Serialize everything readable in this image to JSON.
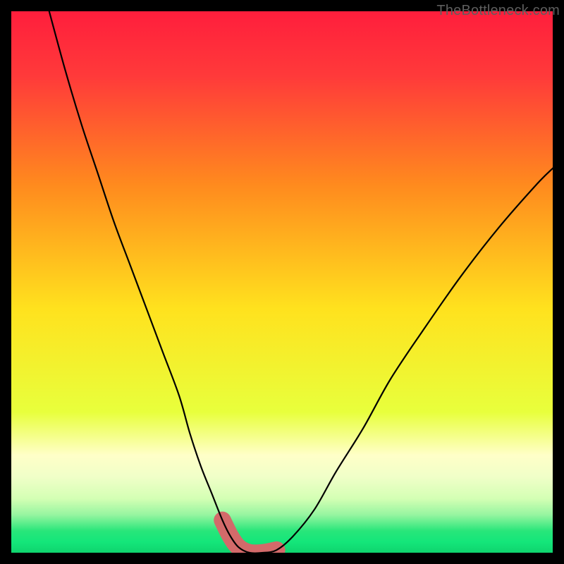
{
  "watermark": {
    "text": "TheBottleneck.com"
  },
  "palette": {
    "red": "#ff1e3c",
    "orange": "#ff8a1e",
    "yellow": "#ffe21e",
    "lime": "#d4ff1e",
    "pale": "#eaffbe",
    "green": "#14e67a",
    "green2": "#0fd46e",
    "curve": "#000000",
    "band": "#d36a6a"
  },
  "chart_data": {
    "type": "line",
    "title": "",
    "xlabel": "",
    "ylabel": "",
    "xlim": [
      0,
      100
    ],
    "ylim": [
      0,
      100
    ],
    "series": [
      {
        "name": "bottleneck-curve",
        "x": [
          7,
          10,
          13,
          16,
          19,
          22,
          25,
          28,
          31,
          33,
          35,
          37,
          39,
          40.5,
          42,
          44,
          46.5,
          49,
          52,
          56,
          60,
          65,
          70,
          76,
          83,
          90,
          97,
          100
        ],
        "values": [
          100,
          89,
          79,
          70,
          61,
          53,
          45,
          37,
          29,
          22,
          16,
          11,
          6,
          3,
          1,
          0,
          0,
          0.5,
          3,
          8,
          15,
          23,
          32,
          41,
          51,
          60,
          68,
          71
        ]
      }
    ],
    "band": {
      "x_start": 38,
      "x_end": 51,
      "thickness_pct": 3.2
    },
    "gradient_stops": [
      {
        "pct": 0,
        "color": "#ff1e3c"
      },
      {
        "pct": 12,
        "color": "#ff3a3a"
      },
      {
        "pct": 32,
        "color": "#ff8a1e"
      },
      {
        "pct": 55,
        "color": "#ffe21e"
      },
      {
        "pct": 74,
        "color": "#e8ff3c"
      },
      {
        "pct": 82,
        "color": "#ffffc8"
      },
      {
        "pct": 86,
        "color": "#f0ffc8"
      },
      {
        "pct": 90,
        "color": "#d4ffb4"
      },
      {
        "pct": 93,
        "color": "#96f5a0"
      },
      {
        "pct": 96,
        "color": "#28e67a"
      },
      {
        "pct": 98,
        "color": "#14e67a"
      },
      {
        "pct": 100,
        "color": "#0fd46e"
      }
    ]
  }
}
